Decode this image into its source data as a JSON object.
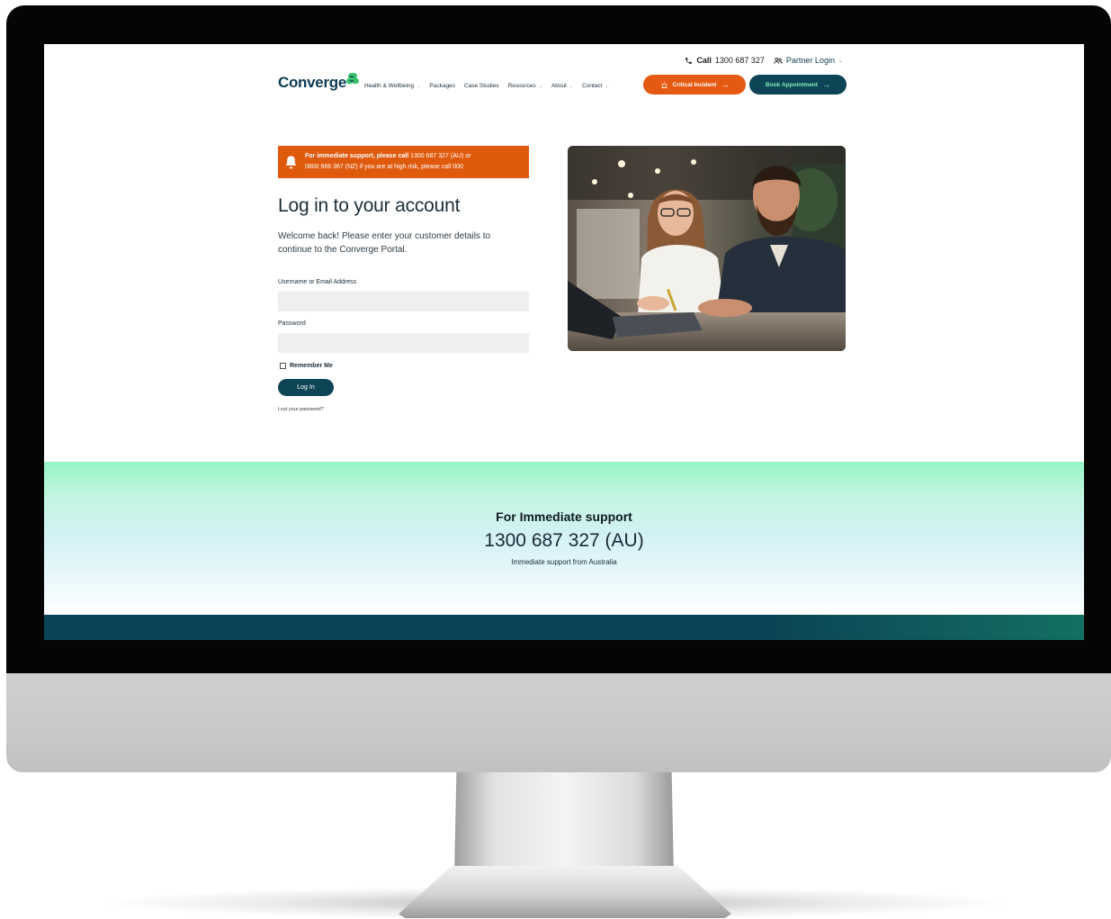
{
  "header": {
    "call_label": "Call",
    "call_number": "1300 687 327",
    "partner_login": "Partner Login",
    "logo_text": "Converge",
    "nav": [
      {
        "label": "Health & Wellbeing",
        "has_dropdown": true
      },
      {
        "label": "Packages",
        "has_dropdown": false
      },
      {
        "label": "Case Studies",
        "has_dropdown": false
      },
      {
        "label": "Resources",
        "has_dropdown": true
      },
      {
        "label": "About",
        "has_dropdown": true
      },
      {
        "label": "Contact",
        "has_dropdown": true
      }
    ],
    "critical_incident": "Critical Incident",
    "book_appointment": "Book Appointment"
  },
  "alert": {
    "bold": "For immediate support, please call",
    "line1_rest": " 1300 687 327 (AU) or",
    "line2": "0800 666 367 (NZ) if you are at high risk, please call 000"
  },
  "login": {
    "title": "Log in to your account",
    "subtitle": "Welcome back! Please enter your customer details to continue to the Converge Portal.",
    "username_label": "Username or Email Address",
    "username_value": "",
    "password_label": "Password",
    "password_value": "",
    "remember_me": "Remember Me",
    "remember_checked": false,
    "login_button": "Log In",
    "lost_password": "Lost your password?"
  },
  "support": {
    "title": "For Immediate support",
    "number": "1300 687 327 (AU)",
    "caption": "Immediate support from Australia"
  },
  "colors": {
    "brand_navy": "#0e4556",
    "accent_orange": "#e55a12",
    "accent_mint": "#7ff0b8"
  }
}
